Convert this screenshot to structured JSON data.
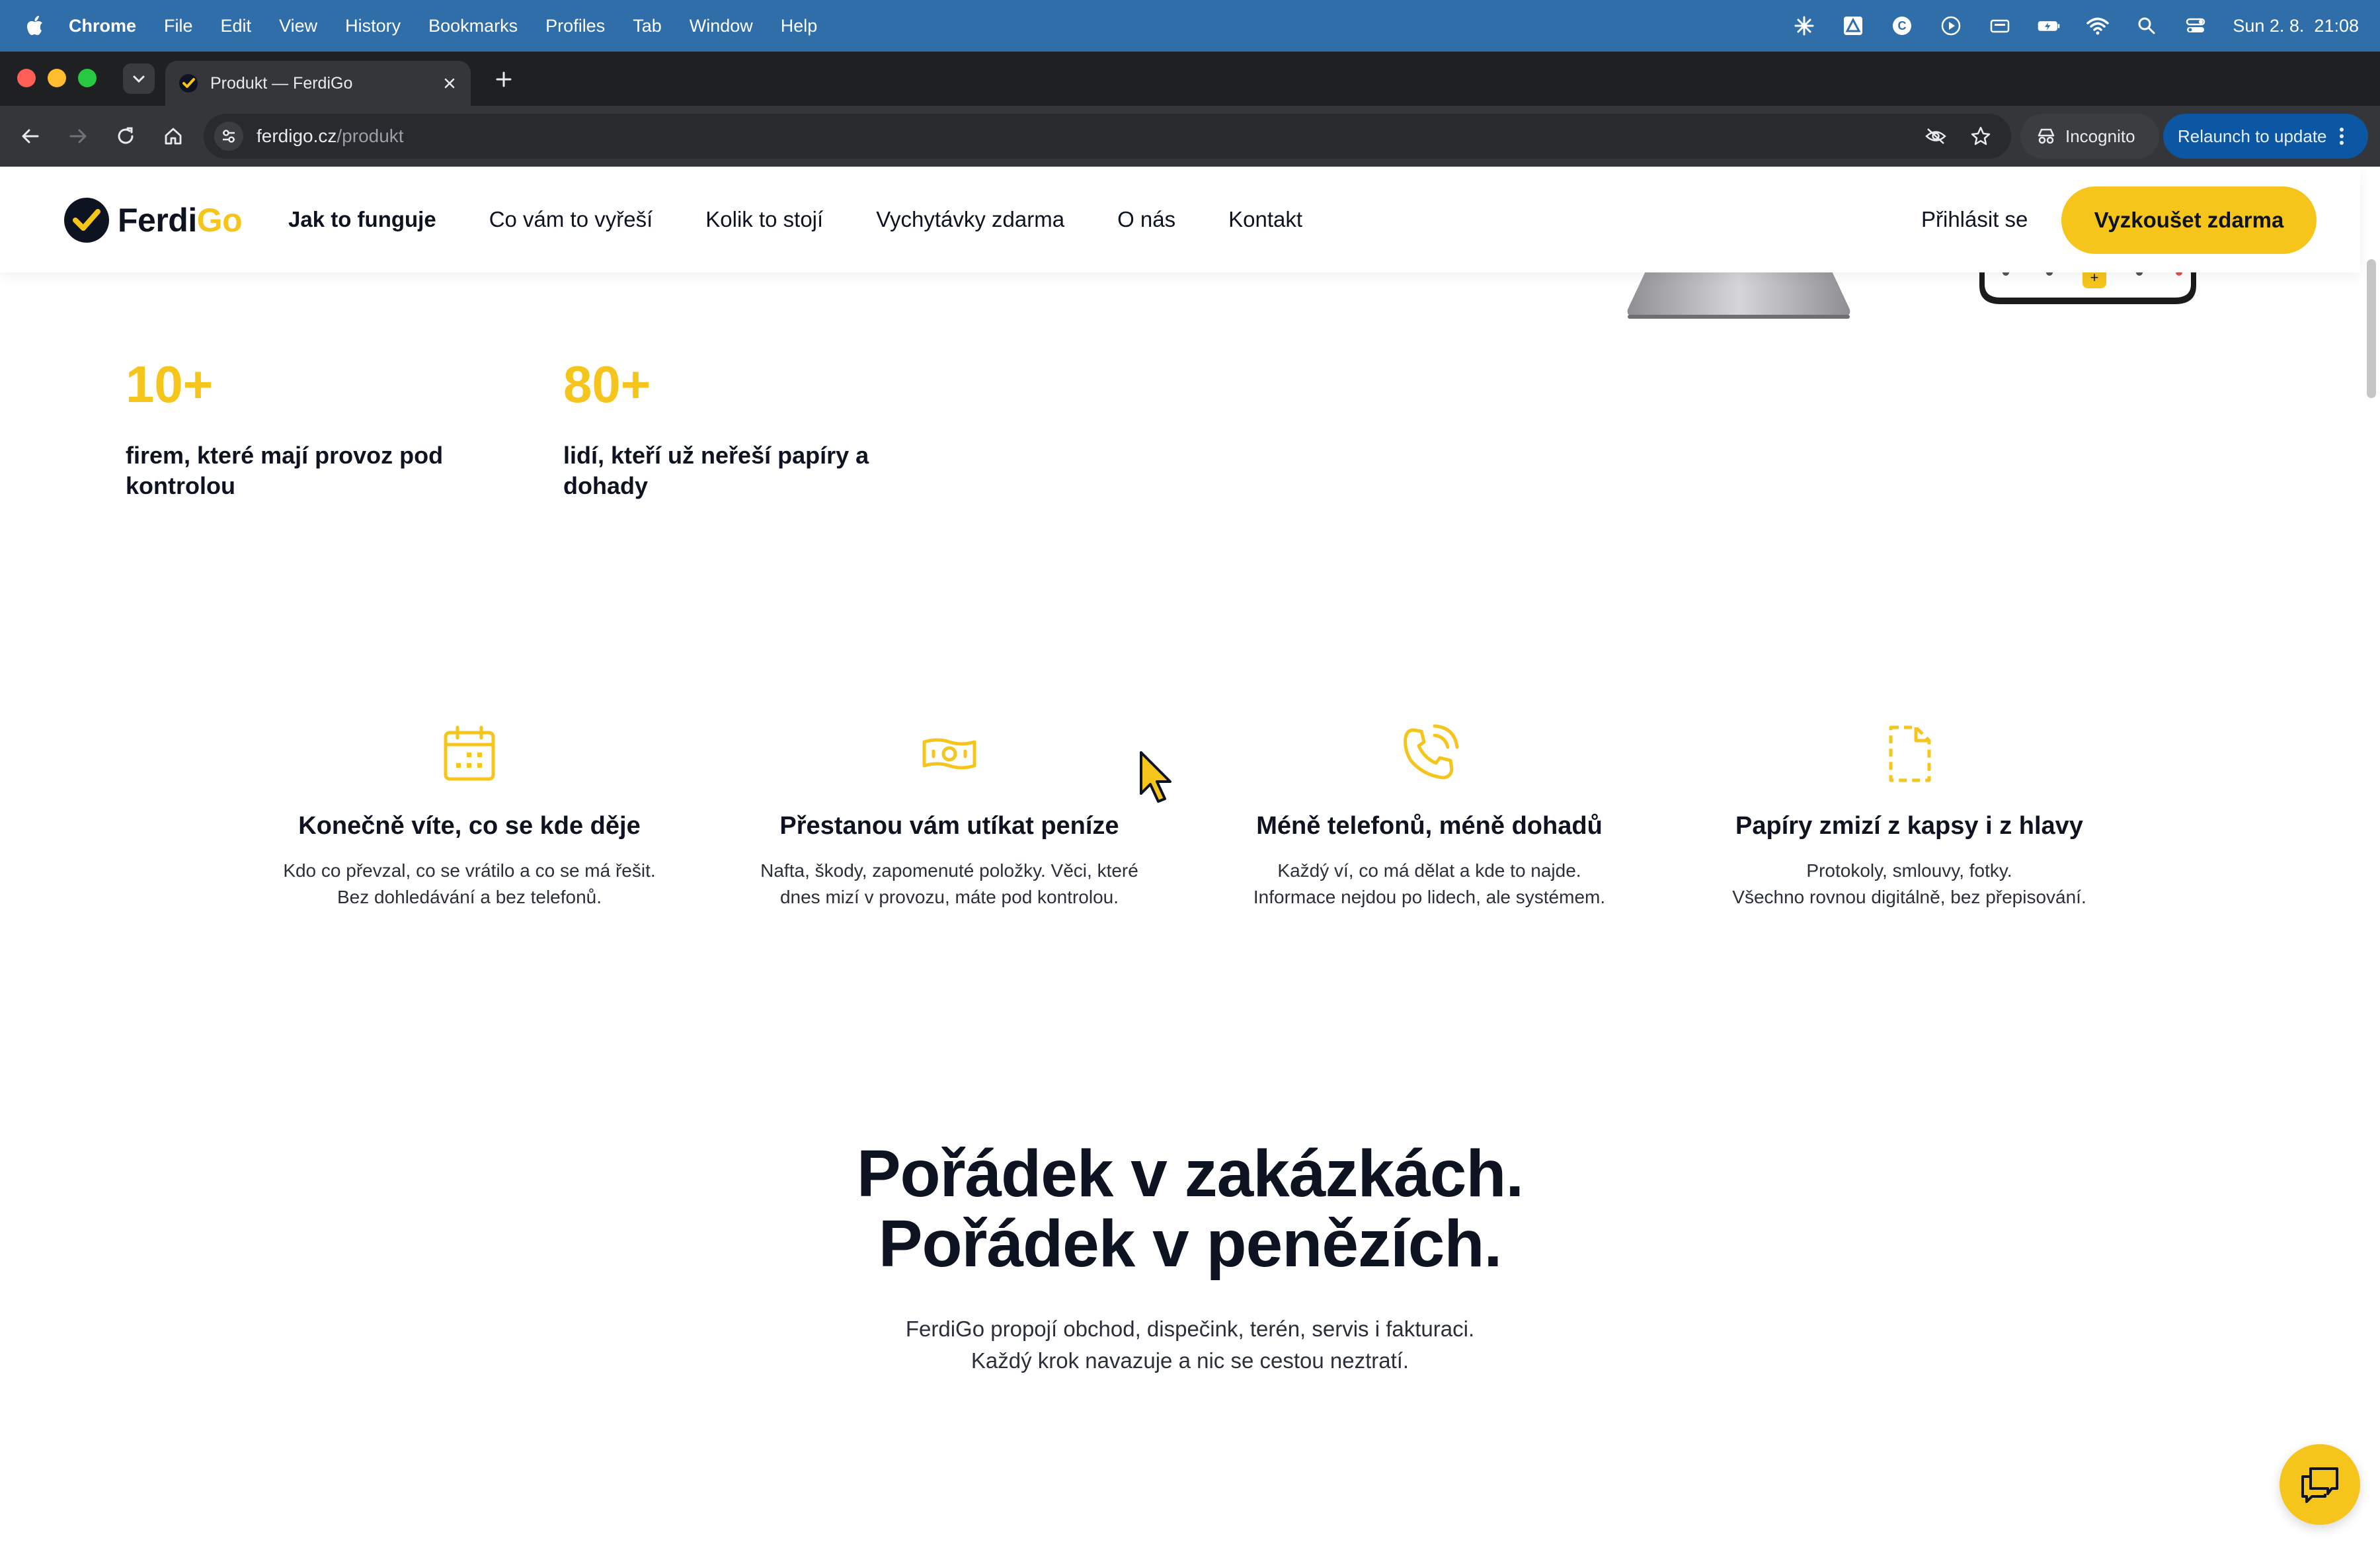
{
  "menubar": {
    "app": "Chrome",
    "items": [
      "File",
      "Edit",
      "View",
      "History",
      "Bookmarks",
      "Profiles",
      "Tab",
      "Window",
      "Help"
    ],
    "clock": "Sun 2. 8.  21:08"
  },
  "browser": {
    "tab_title": "Produkt — FerdiGo",
    "url_host": "ferdigo.cz",
    "url_path": "/produkt",
    "incognito_label": "Incognito",
    "relaunch_label": "Relaunch to update"
  },
  "header": {
    "logo_primary": "Ferdi",
    "logo_accent": "Go",
    "nav": [
      "Jak to funguje",
      "Co vám to vyřeší",
      "Kolik to stojí",
      "Vychytávky zdarma",
      "O nás",
      "Kontakt"
    ],
    "login": "Přihlásit se",
    "cta": "Vyzkoušet zdarma"
  },
  "stats": [
    {
      "number": "10+",
      "text": "firem, které mají provoz pod kontrolou"
    },
    {
      "number": "80+",
      "text": "lidí, kteří už neřeší papíry a dohady"
    }
  ],
  "features": [
    {
      "icon": "calendar-icon",
      "title": "Konečně víte, co se kde děje",
      "line1": "Kdo co převzal, co se vrátilo a co se má řešit.",
      "line2": "Bez dohledávání a bez telefonů."
    },
    {
      "icon": "banknote-icon",
      "title": "Přestanou vám utíkat peníze",
      "line1": "Nafta, škody, zapomenuté položky. Věci, které",
      "line2": "dnes mizí v provozu, máte pod kontrolou."
    },
    {
      "icon": "phone-call-icon",
      "title": "Méně telefonů, méně dohadů",
      "line1": "Každý ví, co má dělat a kde to najde.",
      "line2": "Informace nejdou po lidech, ale systémem."
    },
    {
      "icon": "document-icon",
      "title": "Papíry zmizí z kapsy i z hlavy",
      "line1": "Protokoly, smlouvy, fotky.",
      "line2": "Všechno rovnou digitálně, bez přepisování."
    }
  ],
  "section": {
    "heading_line1": "Pořádek v zakázkách.",
    "heading_line2": "Pořádek v penězích.",
    "sub_line1": "FerdiGo propojí obchod, dispečink, terén, servis i fakturaci.",
    "sub_line2": "Každý krok navazuje a nic se cestou neztratí."
  },
  "colors": {
    "brand_yellow": "#f5c51c",
    "text_dark": "#0d1321",
    "menubar_blue": "#2f6ea8"
  }
}
